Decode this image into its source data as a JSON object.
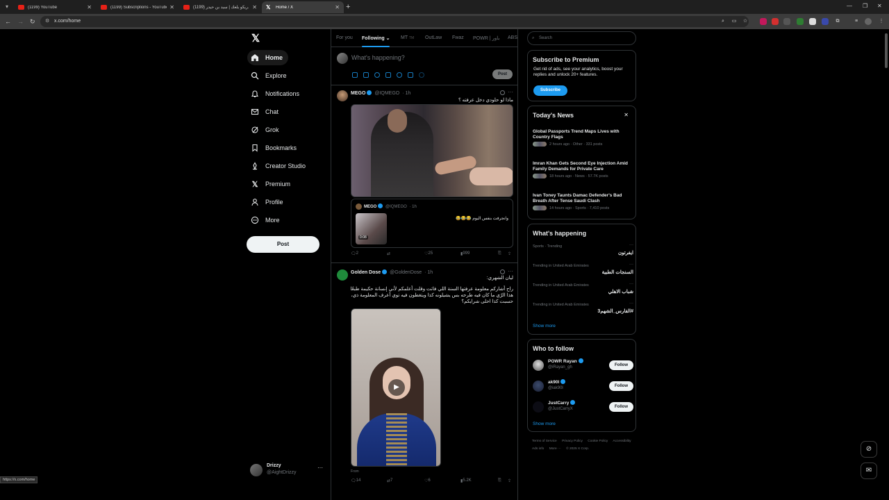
{
  "browser": {
    "tabs": [
      {
        "title": "(1199) YouTube",
        "icon": "youtube-icon",
        "active": false
      },
      {
        "title": "(1199) Subscriptions - YouTube",
        "icon": "youtube-icon",
        "active": false
      },
      {
        "title": "(1199) ريكو يلعك | سيد بن حيدر...",
        "icon": "youtube-icon",
        "active": false
      },
      {
        "title": "Home / X",
        "icon": "x-logo-icon",
        "active": true
      }
    ],
    "url": "x.com/home",
    "status_url": "https://x.com/home"
  },
  "nav": {
    "logo": "X",
    "items": [
      {
        "label": "Home",
        "icon": "home-icon",
        "active": true
      },
      {
        "label": "Explore",
        "icon": "search-icon"
      },
      {
        "label": "Notifications",
        "icon": "bell-icon"
      },
      {
        "label": "Chat",
        "icon": "mail-icon"
      },
      {
        "label": "Grok",
        "icon": "grok-icon"
      },
      {
        "label": "Bookmarks",
        "icon": "bookmark-icon"
      },
      {
        "label": "Creator Studio",
        "icon": "creator-icon"
      },
      {
        "label": "Premium",
        "icon": "x-logo-icon"
      },
      {
        "label": "Profile",
        "icon": "person-icon"
      },
      {
        "label": "More",
        "icon": "more-circle-icon"
      }
    ],
    "post_label": "Post",
    "account": {
      "name": "Drizzy",
      "handle": "@AightDrizzy"
    }
  },
  "feed": {
    "tabs": [
      "For you",
      "Following",
      "MT",
      "OutLaw",
      "Fwaz",
      "POWR | باور",
      "ABS"
    ],
    "compose_placeholder": "What's happening?",
    "compose_post_label": "Post",
    "posts": [
      {
        "name": "MEGO",
        "handle": "@IQMEGO",
        "time": "· 1h",
        "text": "ماذا لو حلودي دخل عرفته ؟",
        "quote": {
          "name": "MEGO",
          "handle": "@IQMEGO",
          "time": "· 1h",
          "text": "وانجرفت بنفس اليوم 😂😂😂",
          "duration": "0:08"
        },
        "stats": {
          "replies": "2",
          "retweets": "",
          "likes": "25",
          "views": "999"
        }
      },
      {
        "name": "Golden Dose",
        "handle": "@GoldenDose",
        "time": "· 1h",
        "text_title": "ليان الشهري:",
        "text_body": "راح أشاركم معلومة عرفتها السنة اللي فاتت وقلت أعلمكم لأني إنسانة حكيمة طبعًا هذا الرّي ما كان فيه طرحه بس يشيلونه كذا ويتغطون فيه توي أعرف المعلومة ذي، حسبت كذا احلى شرايكم؟",
        "from": "From ",
        "stats": {
          "replies": "14",
          "retweets": "7",
          "likes": "6",
          "views": "5.2K"
        }
      }
    ]
  },
  "right": {
    "search_placeholder": "Search",
    "premium": {
      "title": "Subscribe to Premium",
      "desc": "Get rid of ads, see your analytics, boost your replies and unlock 20+ features.",
      "button": "Subscribe"
    },
    "news": {
      "title": "Today's News",
      "items": [
        {
          "title": "Global Passports Trend Maps Lives with Country Flags",
          "meta": "2 hours ago · Other · 331 posts"
        },
        {
          "title": "Imran Khan Gets Second Eye Injection Amid Family Demands for Private Care",
          "meta": "18 hours ago · News · 57.7K posts"
        },
        {
          "title": "Ivan Toney Taunts Damac Defender's Bad Breath After Tense Saudi Clash",
          "meta": "14 hours ago · Sports · 7,410 posts"
        }
      ]
    },
    "happening": {
      "title": "What's happening",
      "trends": [
        {
          "context": "Sports · Trending",
          "name": "ايفرتون"
        },
        {
          "context": "Trending in United Arab Emirates",
          "name": "السنجات الطبية"
        },
        {
          "context": "Trending in United Arab Emirates",
          "name": "شباب الاهلي"
        },
        {
          "context": "Trending in United Arab Emirates",
          "name": "#الفارس_الشهم3"
        }
      ],
      "show_more": "Show more"
    },
    "who_to_follow": {
      "title": "Who to follow",
      "users": [
        {
          "name": "POWR Rayan",
          "handle": "@iRayan_gh",
          "button": "Follow"
        },
        {
          "name": "ak90l",
          "handle": "@iak90l",
          "button": "Follow"
        },
        {
          "name": "JustCarry",
          "handle": "@JustCarryX",
          "button": "Follow"
        }
      ],
      "show_more": "Show more"
    },
    "footer": [
      "Terms of Service",
      "Privacy Policy",
      "Cookie Policy",
      "Accessibility",
      "Ads info",
      "More ···",
      "© 2025 X Corp."
    ]
  }
}
